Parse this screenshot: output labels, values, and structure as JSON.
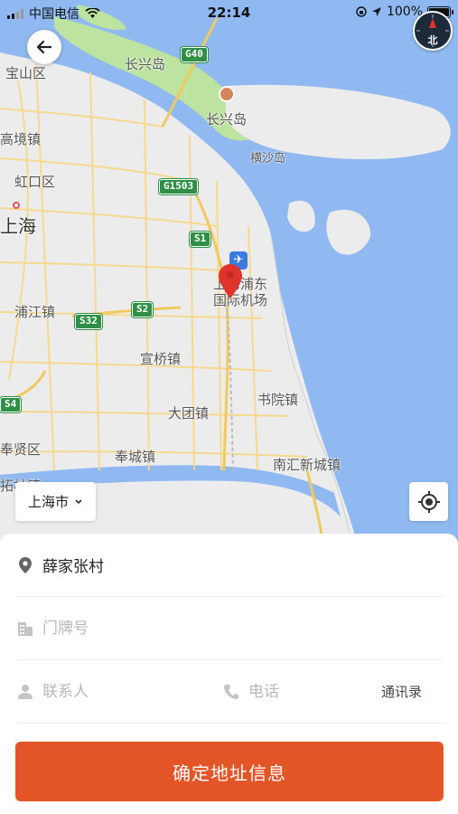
{
  "status_bar": {
    "carrier": "中国电信",
    "time": "22:14",
    "battery": "100%"
  },
  "map": {
    "compass_label": "北",
    "labels": {
      "baoshan": "宝山区",
      "changxingdao_top": "长兴岛",
      "changxingdao": "长兴岛",
      "gaojing": "高境镇",
      "hongkou": "虹口区",
      "shanghai": "上海",
      "hengsha": "横沙岛",
      "airport_line1": "上海浦东",
      "airport_line2": "国际机场",
      "pujiang": "浦江镇",
      "xuanqiao": "宣桥镇",
      "shuyuan": "书院镇",
      "datuan": "大团镇",
      "fengxian": "奉贤区",
      "fengcheng": "奉城镇",
      "nanhui": "南汇新城镇",
      "zhelin": "拓林镇"
    },
    "shields": {
      "g40": "G40",
      "g1503": "G1503",
      "s1": "S1",
      "s2": "S2",
      "s32": "S32",
      "s4": "S4"
    },
    "city_selector": "上海市"
  },
  "form": {
    "address": "薛家张村",
    "house_number_placeholder": "门牌号",
    "contact_placeholder": "联系人",
    "phone_placeholder": "电话",
    "contacts_link": "通讯录",
    "confirm_button": "确定地址信息"
  },
  "colors": {
    "accent": "#e35527",
    "water": "#8fb9f0",
    "land": "#ececec",
    "island_green": "#bde3a0",
    "road": "#f6d98a",
    "shield": "#2f8f46",
    "pin": "#e0332c"
  }
}
